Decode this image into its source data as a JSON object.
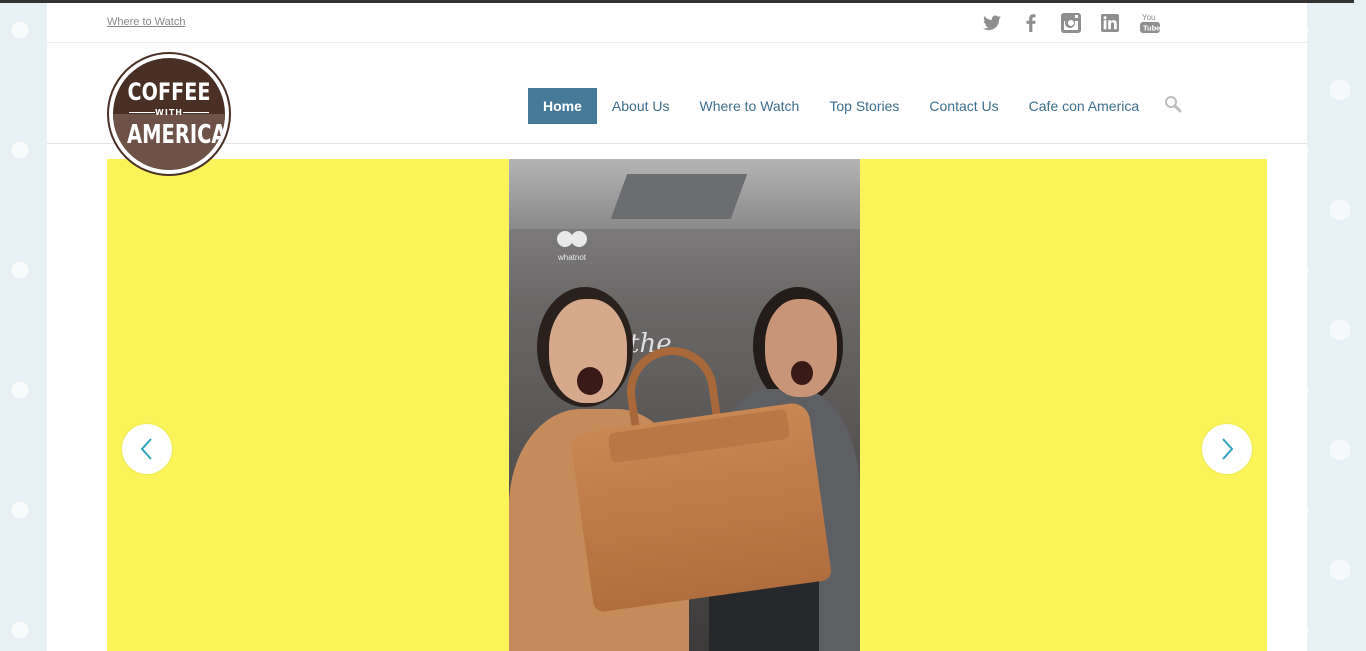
{
  "utility_bar": {
    "link": "Where to Watch",
    "social": [
      "twitter-icon",
      "facebook-icon",
      "instagram-icon",
      "linkedin-icon",
      "youtube-icon"
    ]
  },
  "logo": {
    "line1": "COFFEE",
    "line2": "WITH",
    "line3": "AMERICA"
  },
  "nav": {
    "items": [
      "Home",
      "About Us",
      "Where to Watch",
      "Top Stories",
      "Contact Us",
      "Cafe con America"
    ],
    "active": "Home"
  },
  "slider": {
    "background": "#faf35a",
    "video_watermark": "whatnot",
    "neon_text": "the"
  },
  "colors": {
    "nav_active": "#477998",
    "nav_text": "#3d6f8e",
    "arrow": "#2fa3bc"
  }
}
